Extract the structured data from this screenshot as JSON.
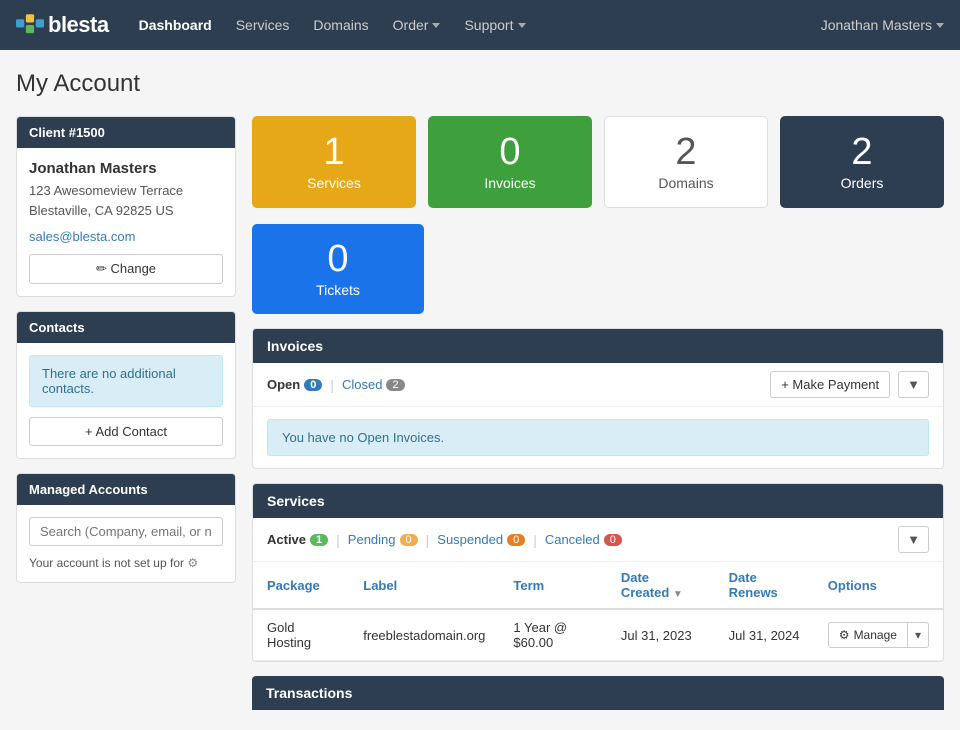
{
  "navbar": {
    "brand": "blesta",
    "links": [
      {
        "label": "Dashboard",
        "active": true,
        "has_caret": false
      },
      {
        "label": "Services",
        "active": false,
        "has_caret": false
      },
      {
        "label": "Domains",
        "active": false,
        "has_caret": false
      },
      {
        "label": "Order",
        "active": false,
        "has_caret": true
      },
      {
        "label": "Support",
        "active": false,
        "has_caret": true
      }
    ],
    "user": "Jonathan Masters",
    "user_caret": true
  },
  "page": {
    "title": "My Account"
  },
  "sidebar": {
    "client_header": "Client #1500",
    "client_name": "Jonathan Masters",
    "client_address_line1": "123 Awesomeview Terrace",
    "client_address_line2": "Blestaville, CA 92825 US",
    "client_email": "sales@blesta.com",
    "change_button": "Change",
    "contacts_header": "Contacts",
    "no_contacts_msg": "There are no additional contacts.",
    "add_contact_button": "+ Add Contact",
    "managed_header": "Managed Accounts",
    "managed_search_placeholder": "Search (Company, email, or n",
    "managed_msg": "Your account is not set up for",
    "gear_icon": "⚙"
  },
  "stats": {
    "services": {
      "count": "1",
      "label": "Services"
    },
    "invoices": {
      "count": "0",
      "label": "Invoices"
    },
    "domains": {
      "count": "2",
      "label": "Domains"
    },
    "orders": {
      "count": "2",
      "label": "Orders"
    },
    "tickets": {
      "count": "0",
      "label": "Tickets"
    }
  },
  "invoices": {
    "section_title": "Invoices",
    "tab_open": "Open",
    "tab_open_badge": "0",
    "tab_closed": "Closed",
    "tab_closed_badge": "2",
    "make_payment_button": "+ Make Payment",
    "filter_icon": "▼",
    "no_invoices_msg": "You have no Open Invoices."
  },
  "services": {
    "section_title": "Services",
    "tab_active": "Active",
    "tab_active_badge": "1",
    "tab_pending": "Pending",
    "tab_pending_badge": "0",
    "tab_suspended": "Suspended",
    "tab_suspended_badge": "0",
    "tab_canceled": "Canceled",
    "tab_canceled_badge": "0",
    "col_package": "Package",
    "col_label": "Label",
    "col_term": "Term",
    "col_date_created": "Date Created",
    "col_date_renews": "Date Renews",
    "col_options": "Options",
    "row": {
      "package": "Gold Hosting",
      "label": "freeblestadomain.org",
      "term": "1 Year @ $60.00",
      "date_created": "Jul 31, 2023",
      "date_renews": "Jul 31, 2024",
      "manage_button": "⚙ Manage",
      "manage_caret": "▾"
    }
  },
  "transactions": {
    "section_title": "Transactions"
  }
}
